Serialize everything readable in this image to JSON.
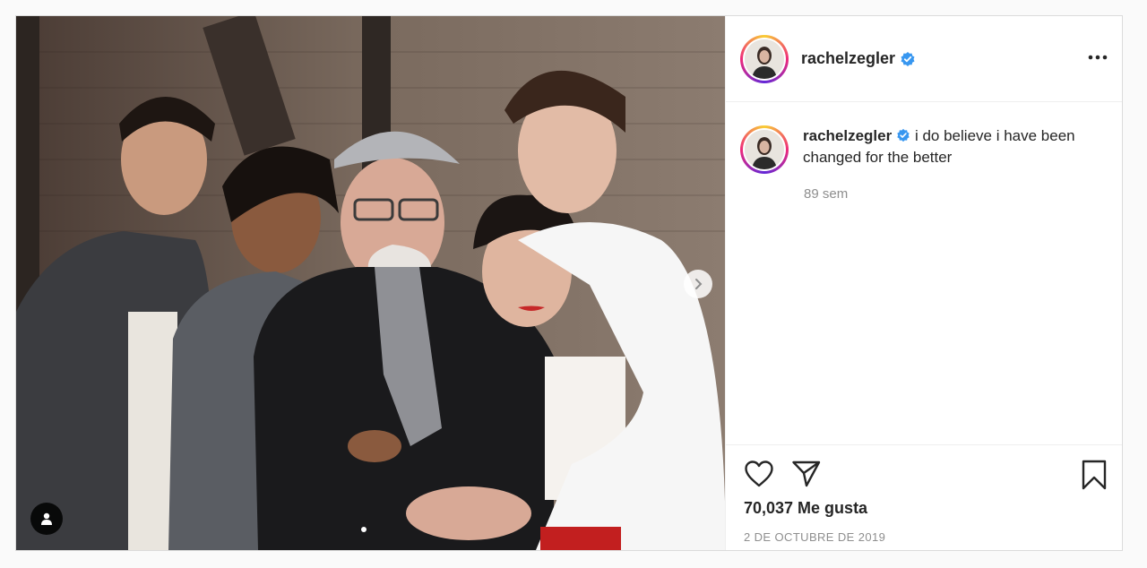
{
  "post": {
    "username": "rachelzegler",
    "verified": true,
    "more_icon": "more-horizontal-icon",
    "photo_alt": "photo",
    "caption": {
      "username": "rachelzegler",
      "text": "i do believe i have been changed for the better",
      "time_ago": "89 sem"
    },
    "likes": "70,037 Me gusta",
    "date": "2 DE OCTUBRE DE 2019",
    "icons": {
      "like": "heart-icon",
      "share": "paper-plane-icon",
      "save": "bookmark-icon",
      "next": "chevron-right-icon",
      "tags": "user-tag-icon"
    },
    "colors": {
      "verified": "#3897f0",
      "background": "#fafafa",
      "muted": "#8e8e8e"
    }
  }
}
